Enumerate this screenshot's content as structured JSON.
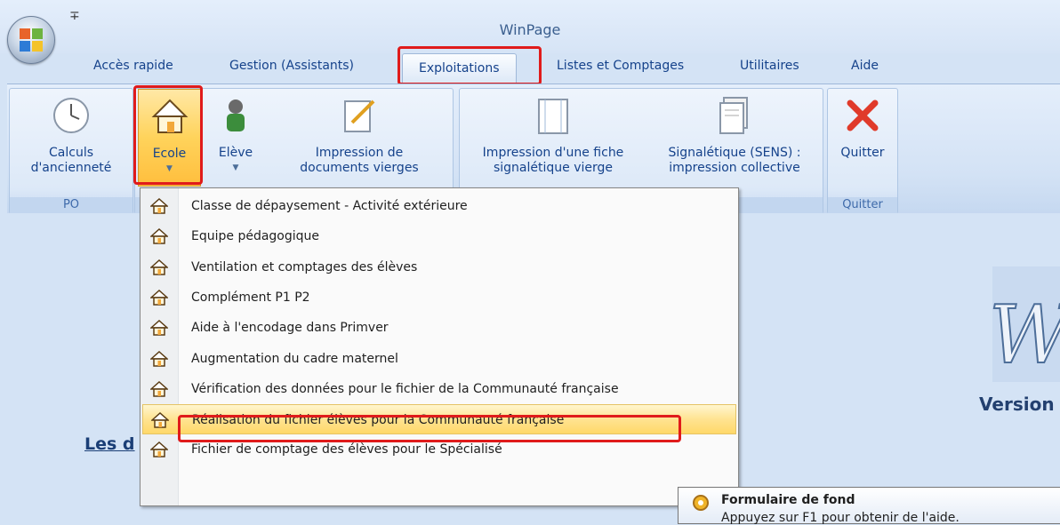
{
  "window": {
    "title": "WinPage"
  },
  "qat": {
    "customize_symbol": "∓"
  },
  "tabs": [
    {
      "label": "Accès rapide"
    },
    {
      "label": "Gestion (Assistants)"
    },
    {
      "label": "Exploitations"
    },
    {
      "label": "Listes et Comptages"
    },
    {
      "label": "Utilitaires"
    },
    {
      "label": "Aide"
    }
  ],
  "ribbon": {
    "calculs": "Calculs\nd'ancienneté",
    "ecole": "Ecole",
    "eleve": "Elève",
    "impression_docs": "Impression de\ndocuments vierges",
    "impression_fiche": "Impression d'une fiche\nsignalétique vierge",
    "signaletique": "Signalétique (SENS) :\nimpression collective",
    "quitter": "Quitter",
    "group_po": "PO",
    "group_quitter": "Quitter"
  },
  "menu": {
    "items": [
      {
        "label": "Classe de dépaysement - Activité extérieure"
      },
      {
        "label": "Equipe pédagogique"
      },
      {
        "label": "Ventilation et comptages des élèves"
      },
      {
        "label": "Complément P1 P2"
      },
      {
        "label": "Aide à l'encodage dans Primver"
      },
      {
        "label": "Augmentation du cadre maternel"
      },
      {
        "label": "Vérification des données pour le fichier de la Communauté française"
      },
      {
        "label": "Réalisation du fichier élèves pour la Communauté française"
      },
      {
        "label": "Fichier de comptage des élèves pour le Spécialisé"
      }
    ]
  },
  "content": {
    "partial_heading": "Les d",
    "version": "Version"
  },
  "tooltip": {
    "title": "Formulaire de fond",
    "text": "Appuyez sur F1 pour obtenir de l'aide."
  },
  "colors": {
    "highlight": "#e01b1b",
    "hover": "#ffd869"
  }
}
